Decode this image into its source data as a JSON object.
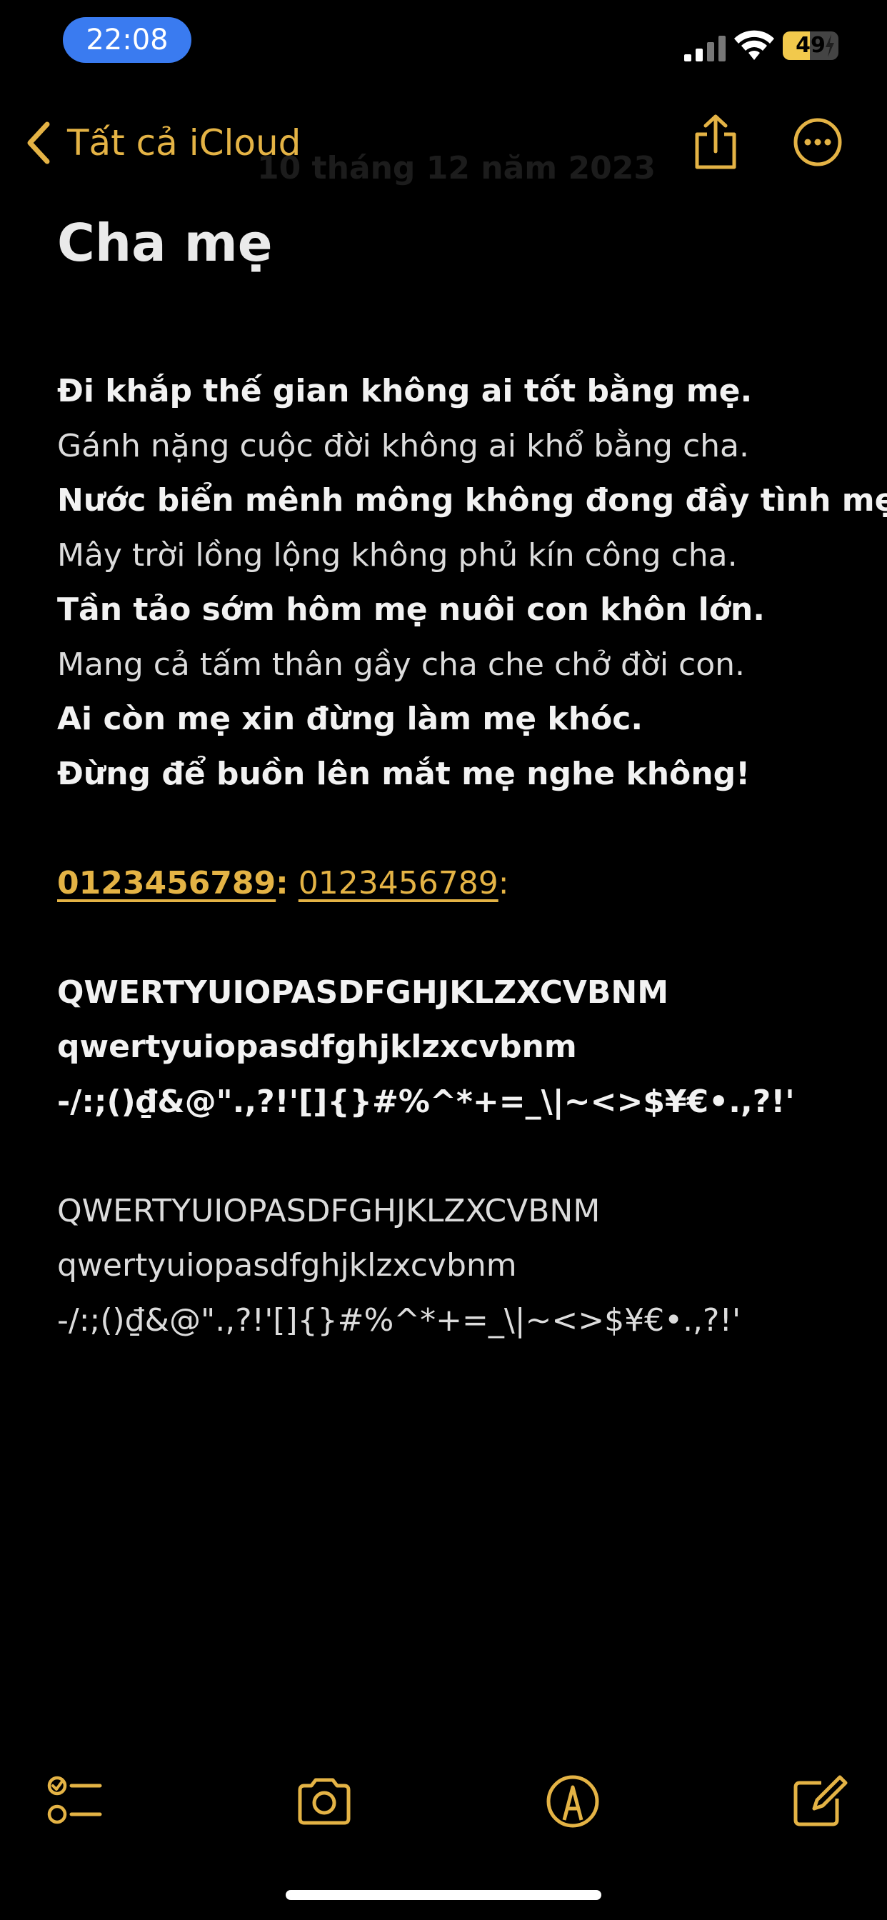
{
  "status_bar": {
    "time": "22:08",
    "battery_percent": "49",
    "battery_level": 0.49,
    "icons": [
      "cellular-signal-icon",
      "wifi-icon",
      "battery-charging-icon"
    ]
  },
  "nav": {
    "back_label": "Tất cả iCloud",
    "ghost_date": "10 tháng 12 năm 2023",
    "icons": [
      "chevron-left-icon",
      "share-icon",
      "more-icon"
    ]
  },
  "note": {
    "title": "Cha mẹ",
    "poem": [
      "Đi khắp thế gian không ai tốt bằng mẹ.",
      "Gánh nặng cuộc đời không ai khổ bằng cha.",
      "Nước biển mênh mông không đong đầy tình mẹ.",
      "Mây trời lồng lộng không phủ kín công cha.",
      "Tần tảo sớm hôm mẹ nuôi con khôn lớn.",
      "Mang cả tấm thân gầy cha che chở đời con.",
      "Ai còn mẹ xin đừng làm mẹ khóc.",
      "Đừng để buồn lên mắt mẹ nghe không!"
    ],
    "phone_bold": "0123456789",
    "phone_light": "0123456789",
    "colon": ":",
    "bold_block": [
      "QWERTYUIOPASDFGHJKLZXCVBNM",
      "qwertyuiopasdfghjklzxcvbnm",
      "-/:;()₫&@\".,?!'[]{}#%^*+=_\\|~<>$¥€•.,?!'"
    ],
    "light_block": [
      "QWERTYUIOPASDFGHJKLZXCVBNM",
      "qwertyuiopasdfghjklzxcvbnm",
      "-/:;()₫&@\".,?!'[]{}#%^*+=_\\|~<>$¥€•.,?!'"
    ]
  },
  "toolbar": {
    "icons": [
      "checklist-icon",
      "camera-icon",
      "markup-pen-icon",
      "compose-icon"
    ]
  },
  "colors": {
    "accent": "#e4b345",
    "background": "#000000",
    "time_pill": "#3a7bf0",
    "battery": "#f2c94c"
  }
}
